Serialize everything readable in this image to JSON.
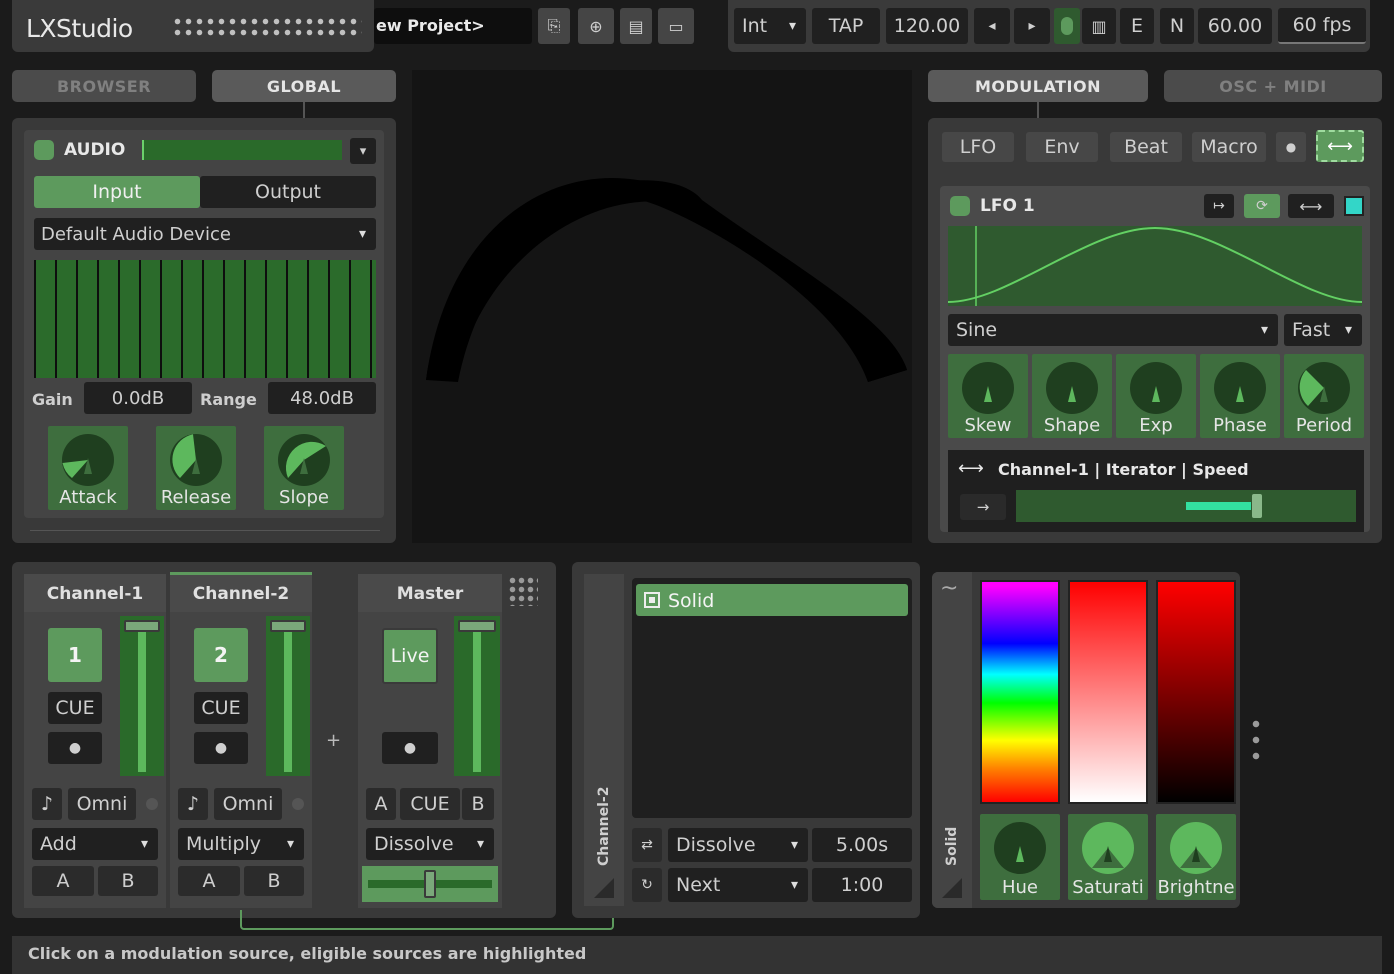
{
  "app": {
    "logo": "LXStudio",
    "project_name": "ew Project>"
  },
  "toolbar": {
    "clock_source": "Int",
    "tap_label": "TAP",
    "bpm": "120.00",
    "prev_label": "◂",
    "next_label": "▸",
    "e_label": "E",
    "n_label": "N",
    "frame_rate_target": "60.00",
    "fps": "60 fps"
  },
  "left_tabs": {
    "browser": "BROWSER",
    "global": "GLOBAL"
  },
  "audio": {
    "title": "AUDIO",
    "input_label": "Input",
    "output_label": "Output",
    "device": "Default Audio Device",
    "gain_label": "Gain",
    "gain_value": "0.0dB",
    "range_label": "Range",
    "range_value": "48.0dB",
    "knobs": [
      {
        "label": "Attack",
        "value": 0.35
      },
      {
        "label": "Release",
        "value": 0.6
      },
      {
        "label": "Slope",
        "value": 0.75
      }
    ]
  },
  "right_tabs": {
    "modulation": "MODULATION",
    "osc_midi": "OSC + MIDI"
  },
  "modulation": {
    "buttons": [
      "LFO",
      "Env",
      "Beat",
      "Macro"
    ],
    "lfo": {
      "title": "LFO 1",
      "waveform": "Sine",
      "speed": "Fast",
      "knobs": [
        {
          "label": "Skew",
          "value": 0.5
        },
        {
          "label": "Shape",
          "value": 0.5
        },
        {
          "label": "Exp",
          "value": 0.5
        },
        {
          "label": "Phase",
          "value": 0.5
        },
        {
          "label": "Period",
          "value": 0.3
        }
      ],
      "mapping": "Channel-1 | Iterator | Speed",
      "mapping_arrow": "→",
      "mapping_amount": 0.38
    }
  },
  "mixer": {
    "channels": [
      {
        "name": "Channel-1",
        "number": "1",
        "cue": "CUE",
        "midi_icon": "♪",
        "omni": "Omni",
        "blend": "Add",
        "a": "A",
        "b": "B",
        "fader": 1.0
      },
      {
        "name": "Channel-2",
        "number": "2",
        "cue": "CUE",
        "midi_icon": "♪",
        "omni": "Omni",
        "blend": "Multiply",
        "a": "A",
        "b": "B",
        "fader": 1.0
      }
    ],
    "add_label": "+",
    "master": {
      "name": "Master",
      "live": "Live",
      "a": "A",
      "cue": "CUE",
      "b": "B",
      "transition": "Dissolve",
      "fader": 1.0,
      "crossfader": 0.5
    }
  },
  "channel_panel": {
    "name": "Channel-2",
    "pattern": "Solid",
    "transition": "Dissolve",
    "transition_time": "5.00s",
    "auto_cycle": "Next",
    "cycle_time": "1:00"
  },
  "solid_panel": {
    "name": "Solid",
    "tilde": "~",
    "knobs": [
      {
        "label": "Hue",
        "value": 0.5
      },
      {
        "label": "Saturati",
        "value": 1.0
      },
      {
        "label": "Brightne",
        "value": 1.0
      }
    ]
  },
  "status": {
    "message": "Click on a modulation source, eligible sources are highlighted"
  },
  "colors": {
    "accent_green": "#5d9a5d",
    "dark_green": "#2f5a2f",
    "cyan": "#33d6c8",
    "lfo_line": "#63d063"
  }
}
